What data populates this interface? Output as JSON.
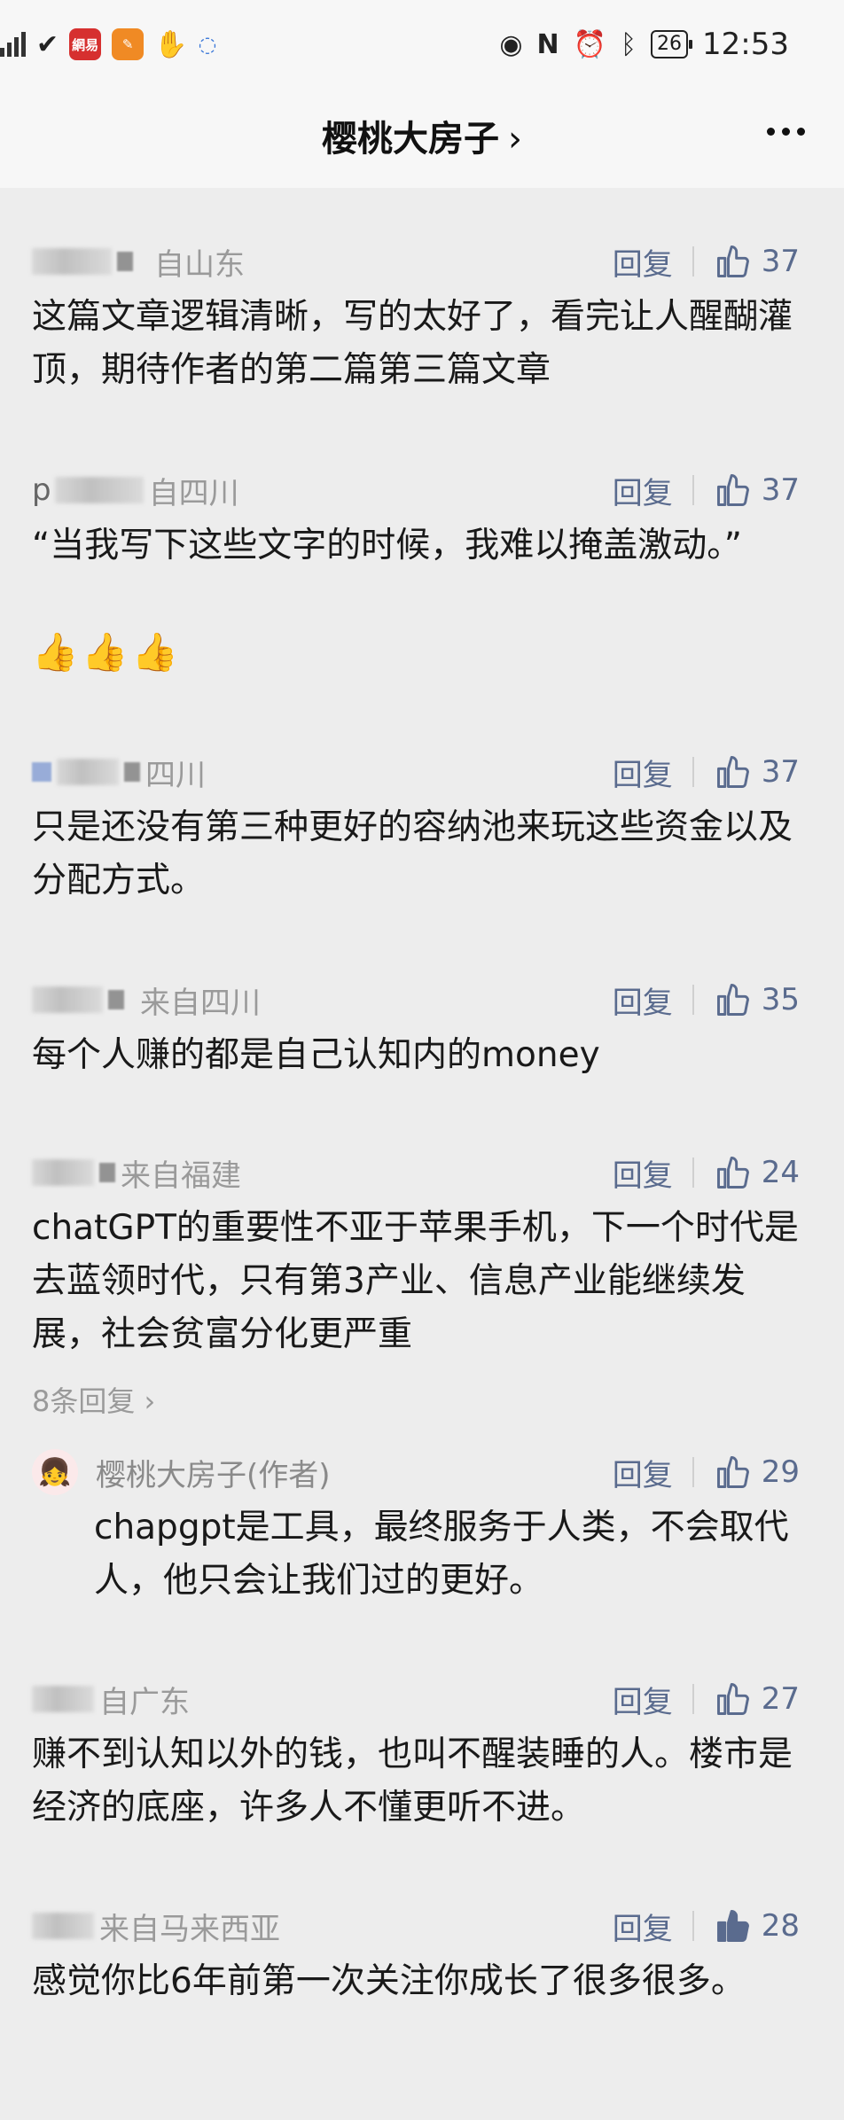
{
  "status_bar": {
    "time": "12:53",
    "battery": "26",
    "apps": [
      {
        "name": "netease-news-icon",
        "text": "網易",
        "color": "#d6302f"
      },
      {
        "name": "orange-app-icon",
        "text": "",
        "color": "#f08a24"
      }
    ]
  },
  "header": {
    "title": "樱桃大房子",
    "chevron": "›"
  },
  "reply_label": "回复",
  "comments": [
    {
      "location": "自山东",
      "likes": "37",
      "liked": false,
      "text": "这篇文章逻辑清晰，写的太好了，看完让人醒醐灌顶，期待作者的第二篇第三篇文章"
    },
    {
      "location": "自四川",
      "prefix": "p",
      "likes": "37",
      "liked": false,
      "text": "“当我写下这些文字的时候，我难以掩盖激动。”",
      "emoji": "👍👍👍"
    },
    {
      "location": "四川",
      "likes": "37",
      "liked": false,
      "text": "只是还没有第三种更好的容纳池来玩这些资金以及分配方式。"
    },
    {
      "location": "来自四川",
      "likes": "35",
      "liked": false,
      "text": "每个人赚的都是自己认知内的money"
    },
    {
      "location": "来自福建",
      "likes": "24",
      "liked": false,
      "text": "chatGPT的重要性不亚于苹果手机，下一个时代是去蓝领时代，只有第3产业、信息产业能继续发展，社会贫富分化更严重",
      "more_replies": "8条回复 ›"
    },
    {
      "location": "自广东",
      "likes": "27",
      "liked": false,
      "text": "赚不到认知以外的钱，也叫不醒装睡的人。楼市是经济的底座，许多人不懂更听不进。"
    },
    {
      "location": "来自马来西亚",
      "likes": "28",
      "liked": true,
      "text": "感觉你比6年前第一次关注你成长了很多很多。"
    }
  ],
  "author_reply": {
    "name": "樱桃大房子(作者)",
    "likes": "29",
    "liked": false,
    "text": "chapgpt是工具，最终服务于人类，不会取代人，他只会让我们过的更好。"
  }
}
